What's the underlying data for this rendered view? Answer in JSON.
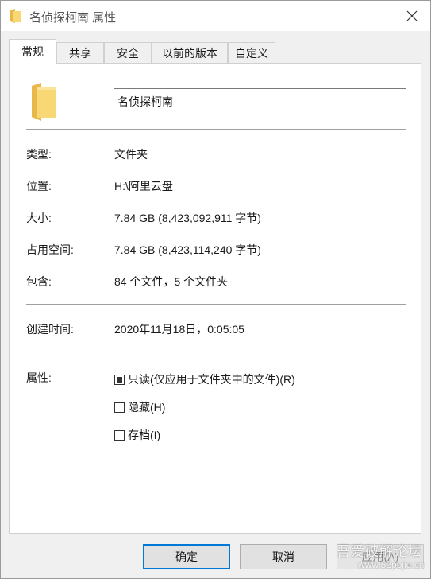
{
  "window": {
    "title": "名侦探柯南 属性",
    "title_icon": "folder-icon",
    "close_icon": "close-icon"
  },
  "tabs": [
    {
      "label": "常规",
      "active": true
    },
    {
      "label": "共享",
      "active": false
    },
    {
      "label": "安全",
      "active": false
    },
    {
      "label": "以前的版本",
      "active": false
    },
    {
      "label": "自定义",
      "active": false
    }
  ],
  "general": {
    "folder_icon": "folder-icon",
    "name_value": "名侦探柯南",
    "rows": [
      {
        "label": "类型:",
        "value": "文件夹"
      },
      {
        "label": "位置:",
        "value": "H:\\阿里云盘"
      },
      {
        "label": "大小:",
        "value": "7.84 GB (8,423,092,911 字节)"
      },
      {
        "label": "占用空间:",
        "value": "7.84 GB (8,423,114,240 字节)"
      },
      {
        "label": "包含:",
        "value": "84 个文件，5 个文件夹"
      }
    ],
    "created": {
      "label": "创建时间:",
      "value": "2020年11月18日，0:05:05"
    },
    "attributes": {
      "label": "属性:",
      "readonly": {
        "label": "只读(仅应用于文件夹中的文件)(R)",
        "state": "indeterminate"
      },
      "hidden": {
        "label": "隐藏(H)",
        "state": "unchecked"
      },
      "archive": {
        "label": "存档(I)",
        "state": "unchecked"
      }
    }
  },
  "footer": {
    "ok": "确定",
    "cancel": "取消",
    "apply": "应用(A)"
  },
  "watermark": {
    "text": "吾爱破解论坛",
    "url": "www.52pojie.cn"
  },
  "colors": {
    "folder_yellow": "#f8d775",
    "folder_dark": "#e8b94a",
    "accent": "#0078d7"
  }
}
